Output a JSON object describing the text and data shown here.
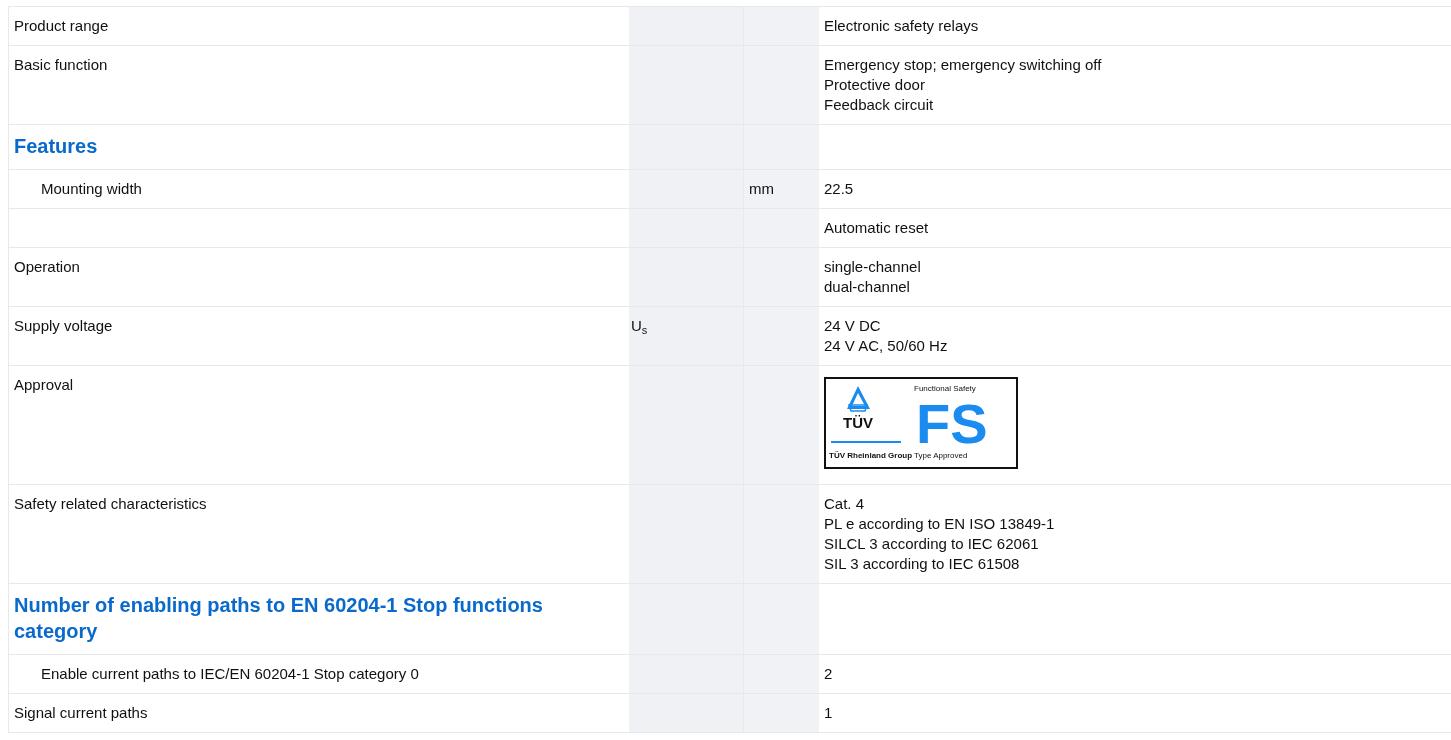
{
  "table": {
    "rows": [
      {
        "kind": "row",
        "label": "Product range",
        "values": [
          "Electronic safety relays"
        ]
      },
      {
        "kind": "row",
        "label": "Basic function",
        "values": [
          "Emergency stop; emergency switching off",
          "Protective door",
          "Feedback circuit"
        ]
      },
      {
        "kind": "heading",
        "label": "Features",
        "children": [
          {
            "kind": "row",
            "label": "Mounting width",
            "unit": "mm",
            "values": [
              "22.5"
            ]
          },
          {
            "kind": "row",
            "values": [
              "Automatic reset"
            ]
          }
        ]
      },
      {
        "kind": "row",
        "label": "Operation",
        "values": [
          "single-channel",
          "dual-channel"
        ]
      },
      {
        "kind": "row",
        "label": "Supply voltage",
        "symbol": "U$_{s}$",
        "values": [
          "24 V DC",
          "24 V AC, 50/60 Hz"
        ]
      },
      {
        "kind": "logo",
        "label": "Approval",
        "logo": {
          "mark": "TÜV",
          "group": "TÜV Rheinland Group",
          "caption_top": "Functional Safety",
          "letters": "FS",
          "caption_bottom": "Type Approved"
        }
      },
      {
        "kind": "row",
        "label": "Safety related characteristics",
        "values": [
          "Cat. 4",
          "PL e according to EN ISO 13849-1",
          "SILCL 3 according to IEC 62061",
          "SIL 3 according to IEC 61508"
        ]
      },
      {
        "kind": "heading",
        "label": "Number of enabling paths to EN 60204-1 Stop functions category",
        "children": [
          {
            "kind": "row",
            "label": "Enable current paths to IEC/EN 60204-1 Stop category 0",
            "values": [
              "2"
            ]
          }
        ]
      },
      {
        "kind": "row",
        "label": "Signal current paths",
        "values": [
          "1"
        ]
      }
    ]
  }
}
